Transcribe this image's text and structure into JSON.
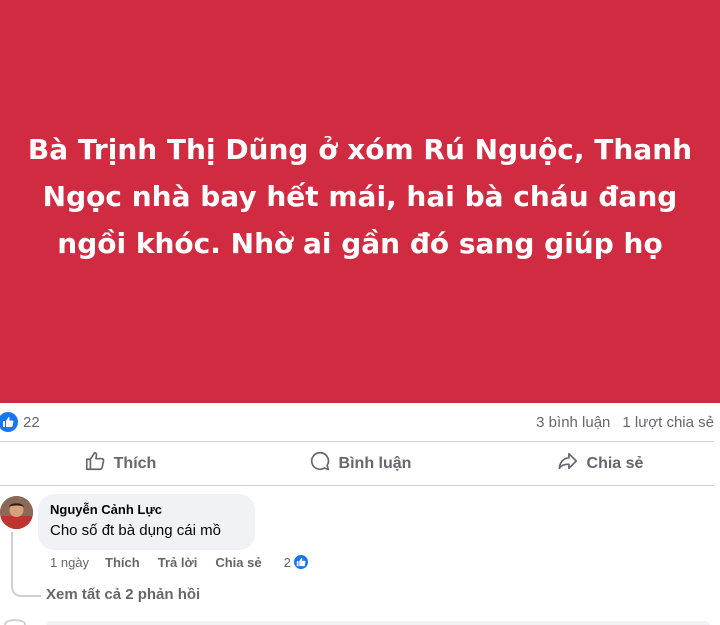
{
  "post": {
    "text": "Bà Trịnh Thị Dũng ở xóm Rú Nguộc, Thanh Ngọc nhà bay hết mái, hai bà cháu đang ngồi khóc. Nhờ ai gần đó sang giúp họ",
    "background_color": "#d02b40"
  },
  "stats": {
    "reaction_icon": "like-icon",
    "reaction_count": "22",
    "comments": "3 bình luận",
    "shares": "1 lượt chia sẻ"
  },
  "actions": {
    "like": {
      "label": "Thích",
      "icon": "thumbs-up-icon"
    },
    "comment": {
      "label": "Bình luận",
      "icon": "comment-icon"
    },
    "share": {
      "label": "Chia sẻ",
      "icon": "share-icon"
    }
  },
  "comment": {
    "author": "Nguyễn Cảnh Lực",
    "text": "Cho số đt bà dụng cái mồ",
    "age": "1 ngày",
    "like_label": "Thích",
    "reply_label": "Trả lời",
    "share_label": "Chia sẻ",
    "reaction_count": "2",
    "view_replies": "Xem tất cả 2 phản hồi"
  },
  "colors": {
    "accent": "#1877f2",
    "muted_text": "#65676b",
    "bubble": "#f0f2f5"
  }
}
